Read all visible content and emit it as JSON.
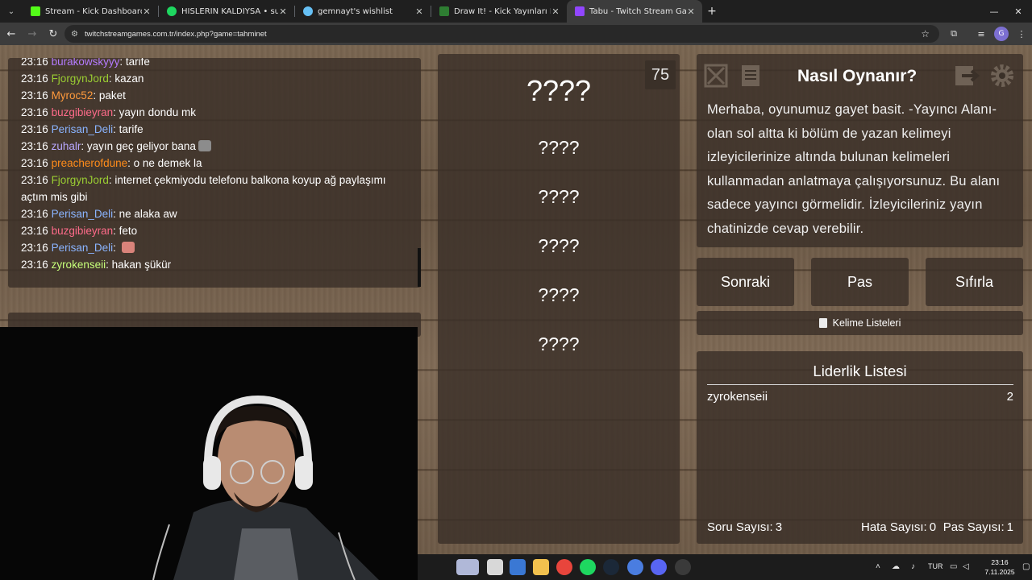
{
  "browser": {
    "tabs": [
      {
        "title": "Stream - Kick Dashboard",
        "color": "#53fc18",
        "active": false
      },
      {
        "title": "HİSLERİN KALDIYSA • sulga, Em",
        "color": "#1ed760",
        "active": false
      },
      {
        "title": "gemnayt's wishlist",
        "color": "#66c0f4",
        "active": false
      },
      {
        "title": "Draw It! - Kick Yayınları İçin Çizı",
        "color": "#2e7d32",
        "active": false
      },
      {
        "title": "Tabu - Twitch Stream Games",
        "color": "#9146ff",
        "active": true
      }
    ],
    "url": "twitchstreamgames.com.tr/index.php?game=tahminet"
  },
  "chat": [
    {
      "time": "23:16",
      "user": "burakowskyyy",
      "color": "#b57bff",
      "msg": "tarife"
    },
    {
      "time": "23:16",
      "user": "FjorgynJord",
      "color": "#9acd32",
      "msg": "kazan"
    },
    {
      "time": "23:16",
      "user": "Myroc52",
      "color": "#ff9a3c",
      "msg": "paket"
    },
    {
      "time": "23:16",
      "user": "buzgibieyran",
      "color": "#ff6b8a",
      "msg": "yayın dondu mk"
    },
    {
      "time": "23:16",
      "user": "Perisan_Deli",
      "color": "#8ab4ff",
      "msg": "tarife"
    },
    {
      "time": "23:16",
      "user": "zuhalr",
      "color": "#b9a8ff",
      "msg": "yayın geç geliyor bana",
      "emote": true
    },
    {
      "time": "23:16",
      "user": "preacherofdune",
      "color": "#ff8c1a",
      "msg": "o ne demek la"
    },
    {
      "time": "23:16",
      "user": "FjorgynJord",
      "color": "#9acd32",
      "msg": "internet çekmiyodu telefonu balkona koyup ağ paylaşımı açtım mis gibi"
    },
    {
      "time": "23:16",
      "user": "Perisan_Deli",
      "color": "#8ab4ff",
      "msg": "ne alaka aw"
    },
    {
      "time": "23:16",
      "user": "buzgibieyran",
      "color": "#ff6b8a",
      "msg": "feto"
    },
    {
      "time": "23:16",
      "user": "Perisan_Deli",
      "color": "#8ab4ff",
      "msg": "",
      "emote": true
    },
    {
      "time": "23:16",
      "user": "zyrokenseii",
      "color": "#c6ff7a",
      "msg": "hakan şükür"
    }
  ],
  "game": {
    "timer": "75",
    "main_word": "????",
    "forbidden_words": [
      "????",
      "????",
      "????",
      "????",
      "????"
    ]
  },
  "howto": {
    "title": "Nasıl Oynanır?",
    "text": "Merhaba, oyunumuz gayet basit. -Yayıncı Alanı- olan sol altta ki bölüm de yazan kelimeyi izleyicilerinize altında bulunan kelimeleri kullanmadan anlatmaya çalışıyorsunuz. Bu alanı sadece yayıncı görmelidir. İzleyicileriniz yayın chatinizde cevap verebilir."
  },
  "buttons": {
    "next": "Sonraki",
    "pass": "Pas",
    "reset": "Sıfırla",
    "word_lists": "Kelime Listeleri"
  },
  "leaderboard": {
    "title": "Liderlik Listesi",
    "entries": [
      {
        "name": "zyrokenseii",
        "score": "2"
      }
    ],
    "stats": {
      "questions_label": "Soru Sayısı:",
      "questions": "3",
      "errors_label": "Hata Sayısı:",
      "errors": "0",
      "passes_label": "Pas Sayısı:",
      "passes": "1"
    }
  },
  "taskbar": {
    "lang": "TUR",
    "time": "23:16",
    "date": "7.11.2025"
  }
}
